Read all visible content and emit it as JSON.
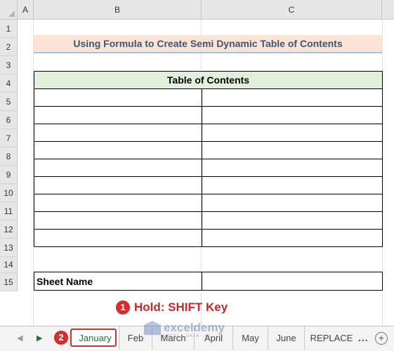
{
  "columns": [
    "A",
    "B",
    "C"
  ],
  "rows": [
    "1",
    "2",
    "3",
    "4",
    "5",
    "6",
    "7",
    "8",
    "9",
    "10",
    "11",
    "12",
    "13",
    "14",
    "15"
  ],
  "title": "Using Formula to Create Semi Dynamic Table of Contents",
  "toc_header": "Table of Contents",
  "sheet_name_label": "Sheet Name",
  "callout_step1": {
    "number": "1",
    "text": "Hold: SHIFT Key"
  },
  "callout_step2": {
    "number": "2"
  },
  "tabs": [
    "January",
    "Feb",
    "March",
    "April",
    "May",
    "June",
    "REPLACE"
  ],
  "more_tabs": "...",
  "add_sheet": "+",
  "watermark": {
    "brand": "exceldemy",
    "tagline": "EXCEL · DATA · BI"
  },
  "colors": {
    "accent_red": "#d32f2f",
    "title_fill": "#fbe3d6",
    "header_fill": "#e2efda",
    "excel_green": "#217346"
  }
}
